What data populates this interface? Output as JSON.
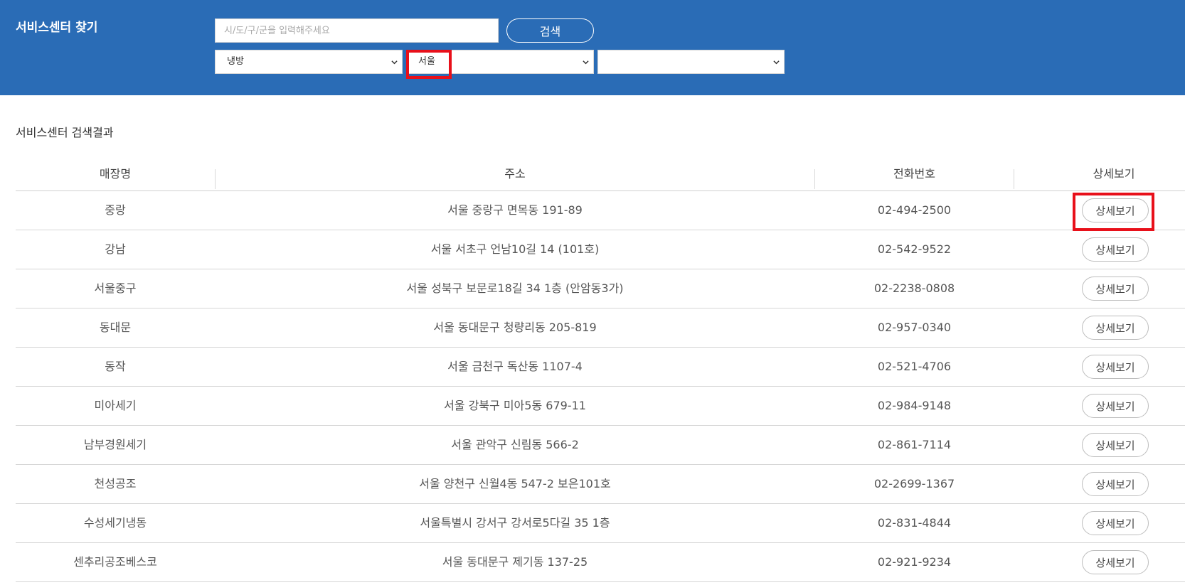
{
  "header": {
    "title": "서비스센터 찾기",
    "search_placeholder": "시/도/구/군을 입력해주세요",
    "search_button": "검색",
    "select_category": "냉방",
    "select_region": "서울",
    "select_district": ""
  },
  "results": {
    "title": "서비스센터 검색결과",
    "columns": [
      "매장명",
      "주소",
      "전화번호",
      "상세보기"
    ],
    "detail_label": "상세보기",
    "rows": [
      {
        "name": "중랑",
        "address": "서울 중랑구 면목동 191-89",
        "phone": "02-494-2500"
      },
      {
        "name": "강남",
        "address": "서울 서초구 언남10길 14 (101호)",
        "phone": "02-542-9522"
      },
      {
        "name": "서울중구",
        "address": "서울 성북구 보문로18길 34 1층 (안암동3가)",
        "phone": "02-2238-0808"
      },
      {
        "name": "동대문",
        "address": "서울 동대문구 청량리동 205-819",
        "phone": "02-957-0340"
      },
      {
        "name": "동작",
        "address": "서울 금천구 독산동 1107-4",
        "phone": "02-521-4706"
      },
      {
        "name": "미아세기",
        "address": "서울 강북구 미아5동 679-11",
        "phone": "02-984-9148"
      },
      {
        "name": "남부경원세기",
        "address": "서울 관악구 신림동 566-2",
        "phone": "02-861-7114"
      },
      {
        "name": "천성공조",
        "address": "서울 양천구 신월4동 547-2 보은101호",
        "phone": "02-2699-1367"
      },
      {
        "name": "수성세기냉동",
        "address": "서울특별시 강서구 강서로5다길 35 1층",
        "phone": "02-831-4844"
      },
      {
        "name": "센추리공조베스코",
        "address": "서울 동대문구 제기동 137-25",
        "phone": "02-921-9234"
      }
    ]
  },
  "colors": {
    "header_bg": "#2a6cb6",
    "highlight": "#e8101a"
  }
}
